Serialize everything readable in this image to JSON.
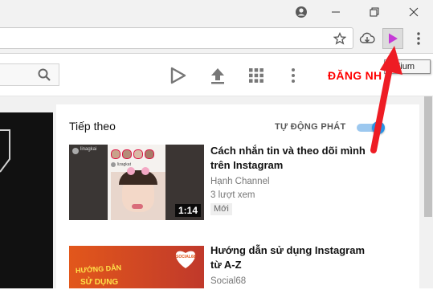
{
  "youtube": {
    "signin_label": "ĐĂNG NH"
  },
  "tooltip": {
    "text": "Iridium"
  },
  "panel": {
    "up_next_label": "Tiếp theo",
    "autoplay_label": "TỰ ĐỘNG PHÁT",
    "autoplay_on": true
  },
  "videos": [
    {
      "title_line1": "Cách nhắn tin và theo dõi mình",
      "title_line2": "trên Instagram",
      "channel": "Hạnh Channel",
      "views": "3 lượt xem",
      "badge": "Mới",
      "duration": "1:14",
      "thumb_top_text": "linagkai",
      "thumb_left_text": "lizagkat"
    },
    {
      "title_line1": "Hướng dẫn sử dụng Instagram",
      "title_line2": "từ A-Z",
      "channel": "Social68",
      "thumb_banner": "HƯỚNG DẪN",
      "thumb_heart": "SOCIAL68",
      "thumb_bottom": "SỬ DỤNG"
    }
  ],
  "colors": {
    "brand_red": "#ff0000",
    "toggle_blue": "#2793e6",
    "arrow_red": "#ee1c24",
    "extension_purple": "#c53ad6"
  }
}
